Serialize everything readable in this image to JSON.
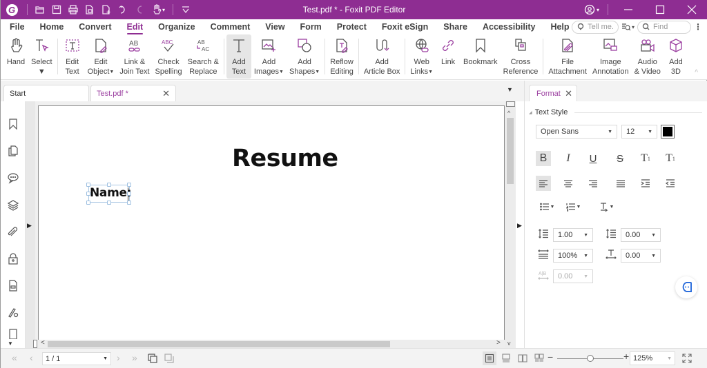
{
  "window": {
    "title": "Test.pdf * - Foxit PDF Editor",
    "logo_letter": "G"
  },
  "quick_access": [
    "open-icon",
    "save-icon",
    "print-icon",
    "create-from-file-icon",
    "new-document-icon",
    "undo-icon",
    "redo-icon",
    "hand-tool-icon",
    "customize-icon"
  ],
  "menu": {
    "items": [
      {
        "label": "File"
      },
      {
        "label": "Home"
      },
      {
        "label": "Convert"
      },
      {
        "label": "Edit",
        "active": true
      },
      {
        "label": "Organize"
      },
      {
        "label": "Comment"
      },
      {
        "label": "View"
      },
      {
        "label": "Form"
      },
      {
        "label": "Protect"
      },
      {
        "label": "Foxit eSign"
      },
      {
        "label": "Share"
      },
      {
        "label": "Accessibility"
      },
      {
        "label": "Help"
      }
    ],
    "tell_me_placeholder": "Tell me.",
    "find_placeholder": "Find"
  },
  "ribbon": {
    "hand": "Hand",
    "select": "Select",
    "edit_text": [
      "Edit",
      "Text"
    ],
    "edit_object": [
      "Edit",
      "Object"
    ],
    "link_join": [
      "Link &",
      "Join Text"
    ],
    "check_spelling": [
      "Check",
      "Spelling"
    ],
    "search_replace": [
      "Search &",
      "Replace"
    ],
    "add_text": [
      "Add",
      "Text"
    ],
    "add_images": [
      "Add",
      "Images"
    ],
    "add_shapes": [
      "Add",
      "Shapes"
    ],
    "reflow_editing": [
      "Reflow",
      "Editing"
    ],
    "add_article_box": [
      "Add",
      "Article Box"
    ],
    "web_links": [
      "Web",
      "Links"
    ],
    "link": "Link",
    "bookmark": "Bookmark",
    "cross_reference": [
      "Cross",
      "Reference"
    ],
    "file_attachment": [
      "File",
      "Attachment"
    ],
    "image_annotation": [
      "Image",
      "Annotation"
    ],
    "audio_video": [
      "Audio",
      "& Video"
    ],
    "add_3d": [
      "Add",
      "3D"
    ]
  },
  "doc_tabs": {
    "start": "Start",
    "active": "Test.pdf *"
  },
  "document": {
    "heading": "Resume",
    "editing_text": "Name:"
  },
  "format_panel": {
    "tab_label": "Format",
    "section": "Text Style",
    "font": "Open Sans",
    "font_size": "12",
    "color": "#000000",
    "bold_active": true,
    "align_left_active": true,
    "line_spacing": "1.00",
    "paragraph_spacing": "0.00",
    "horizontal_scale": "100%",
    "char_spacing": "0.00",
    "word_spacing": "0.00"
  },
  "status": {
    "page": "1 / 1",
    "zoom": "125%",
    "zoom_slider_fraction": 0.5
  },
  "colors": {
    "brand": "#8e2d92",
    "accent_icon": "#9b3fa0",
    "chat_blue": "#2d6fdc"
  }
}
